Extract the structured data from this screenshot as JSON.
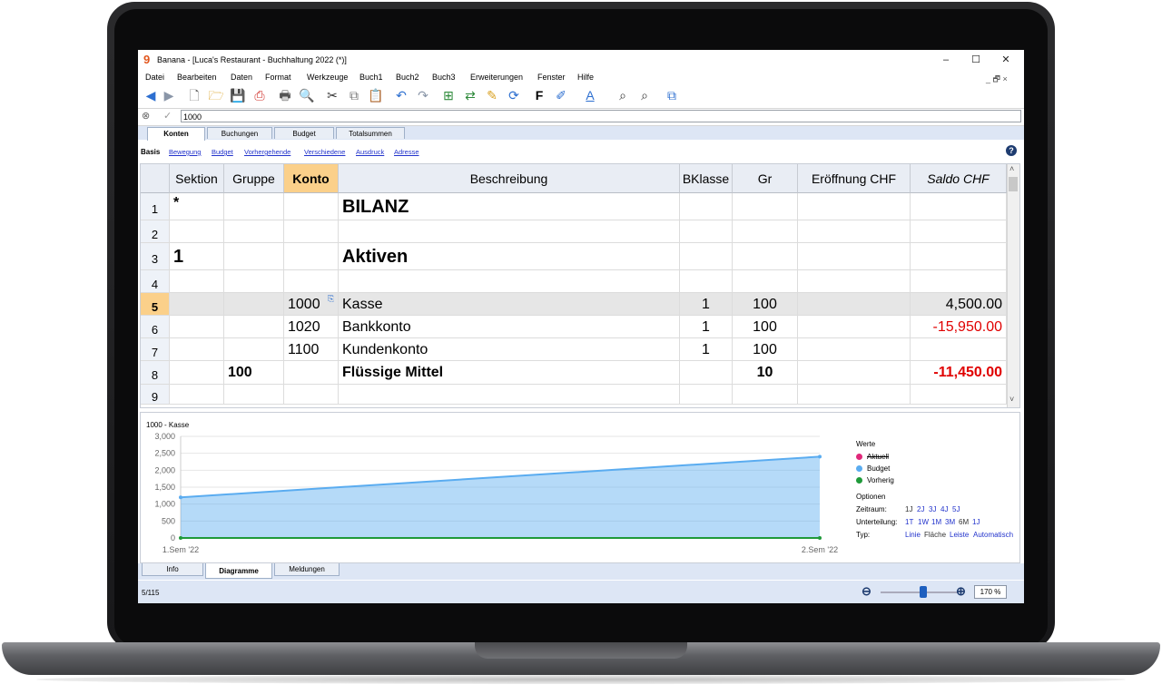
{
  "window": {
    "title": "Banana - [Luca's Restaurant - Buchhaltung 2022 (*)]",
    "app_icon": "9",
    "minimize": "–",
    "maximize": "☐",
    "close": "✕"
  },
  "menu": [
    "Datei",
    "Bearbeiten",
    "Daten",
    "Format",
    "Werkzeuge",
    "Buch1",
    "Buch2",
    "Buch3",
    "Erweiterungen",
    "Fenster",
    "Hilfe"
  ],
  "mdi_controls": "_ 🗗 ×",
  "editbar": {
    "cancel_icon": "⊗",
    "confirm_icon": "✓",
    "value": "1000"
  },
  "tabs": [
    "Konten",
    "Buchungen",
    "Budget",
    "Totalsummen"
  ],
  "subtabs": {
    "active": "Basis",
    "links": [
      "Bewegung",
      "Budget",
      "Vorhergehende",
      "Verschiedene",
      "Ausdruck",
      "Adresse"
    ]
  },
  "help_icon": "?",
  "table": {
    "headers": [
      "Sektion",
      "Gruppe",
      "Konto",
      "Beschreibung",
      "BKlasse",
      "Gr",
      "Eröffnung CHF",
      "Saldo CHF"
    ],
    "rows": [
      {
        "n": "1",
        "sektion": "*",
        "gruppe": "",
        "konto": "",
        "beschreibung": "BILANZ",
        "bklasse": "",
        "gr": "",
        "eroeffnung": "",
        "saldo": ""
      },
      {
        "n": "2",
        "sektion": "",
        "gruppe": "",
        "konto": "",
        "beschreibung": "",
        "bklasse": "",
        "gr": "",
        "eroeffnung": "",
        "saldo": ""
      },
      {
        "n": "3",
        "sektion": "1",
        "gruppe": "",
        "konto": "",
        "beschreibung": "Aktiven",
        "bklasse": "",
        "gr": "",
        "eroeffnung": "",
        "saldo": ""
      },
      {
        "n": "4",
        "sektion": "",
        "gruppe": "",
        "konto": "",
        "beschreibung": "",
        "bklasse": "",
        "gr": "",
        "eroeffnung": "",
        "saldo": ""
      },
      {
        "n": "5",
        "sektion": "",
        "gruppe": "",
        "konto": "1000",
        "beschreibung": "Kasse",
        "bklasse": "1",
        "gr": "100",
        "eroeffnung": "",
        "saldo": "4,500.00"
      },
      {
        "n": "6",
        "sektion": "",
        "gruppe": "",
        "konto": "1020",
        "beschreibung": "Bankkonto",
        "bklasse": "1",
        "gr": "100",
        "eroeffnung": "",
        "saldo": "-15,950.00"
      },
      {
        "n": "7",
        "sektion": "",
        "gruppe": "",
        "konto": "1100",
        "beschreibung": "Kundenkonto",
        "bklasse": "1",
        "gr": "100",
        "eroeffnung": "",
        "saldo": ""
      },
      {
        "n": "8",
        "sektion": "",
        "gruppe": "100",
        "konto": "",
        "beschreibung": "Flüssige Mittel",
        "bklasse": "",
        "gr": "10",
        "eroeffnung": "",
        "saldo": "-11,450.00"
      },
      {
        "n": "9",
        "sektion": "",
        "gruppe": "",
        "konto": "",
        "beschreibung": "",
        "bklasse": "",
        "gr": "",
        "eroeffnung": "",
        "saldo": ""
      }
    ],
    "selected_row": 5,
    "negative_color": "#e00000"
  },
  "chart_data": {
    "type": "area",
    "title": "1000 - Kasse",
    "categories": [
      "1.Sem '22",
      "2.Sem '22"
    ],
    "ylim": [
      0,
      3000
    ],
    "yticks": [
      "3,000",
      "2,500",
      "2,000",
      "1,500",
      "1,000",
      "500",
      "0"
    ],
    "series": [
      {
        "name": "Budget",
        "values": [
          1200,
          2400
        ],
        "color": "#5aacf0"
      },
      {
        "name": "Vorherig",
        "values": [
          0,
          0
        ],
        "color": "#1f9a3a"
      }
    ],
    "grid": true
  },
  "legend": {
    "werte_title": "Werte",
    "items": [
      {
        "label": "Aktuell",
        "color": "#e0287a",
        "strike": true
      },
      {
        "label": "Budget",
        "color": "#5aacf0",
        "strike": false
      },
      {
        "label": "Vorherig",
        "color": "#1f9a3a",
        "strike": false
      }
    ],
    "optionen_title": "Optionen",
    "zeitraum_label": "Zeitraum:",
    "zeitraum_opts": [
      "1J",
      "2J",
      "3J",
      "4J",
      "5J"
    ],
    "unterteilung_label": "Unterteilung:",
    "unterteilung_opts": [
      "1T",
      "1W",
      "1M",
      "3M",
      "6M",
      "1J"
    ],
    "unterteilung_active": "6M",
    "typ_label": "Typ:",
    "typ_opts": [
      "Linie",
      "Fläche",
      "Leiste",
      "Automatisch"
    ],
    "typ_active": "Fläche"
  },
  "bottom_tabs": [
    "Info",
    "Diagramme",
    "Meldungen"
  ],
  "bottom_active": "Diagramme",
  "status": {
    "position": "5/115",
    "zoom": "170 %",
    "zoom_level_pct": 55
  }
}
